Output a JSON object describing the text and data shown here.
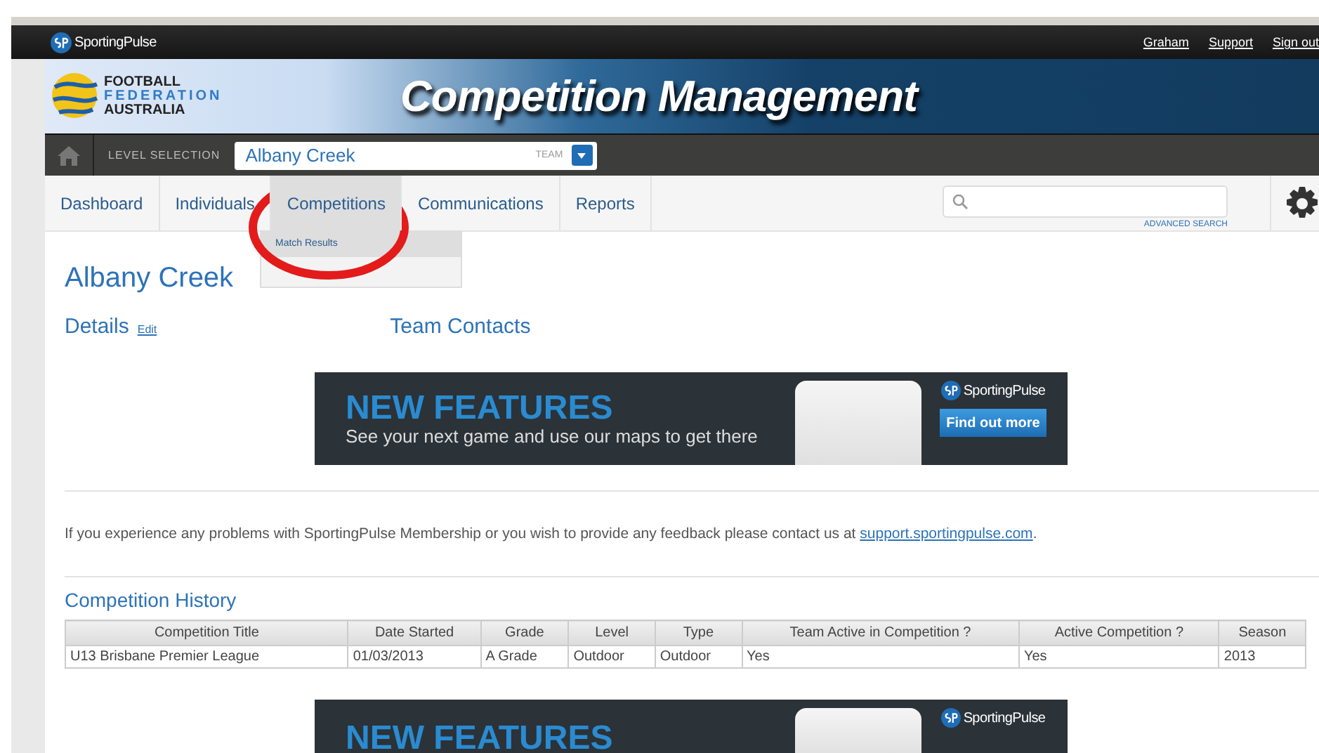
{
  "top_bar": {
    "brand": "SportingPulse",
    "links": [
      "Graham",
      "Support",
      "Sign out"
    ]
  },
  "header": {
    "org_lines": [
      "FOOTBALL",
      "FEDERATION",
      "AUSTRALIA"
    ],
    "title": "Competition Management"
  },
  "level_bar": {
    "label": "LEVEL SELECTION",
    "value": "Albany Creek",
    "level_type": "TEAM"
  },
  "nav": {
    "items": [
      {
        "label": "Dashboard",
        "selected": false
      },
      {
        "label": "Individuals",
        "selected": false
      },
      {
        "label": "Competitions",
        "selected": true
      },
      {
        "label": "Communications",
        "selected": false
      },
      {
        "label": "Reports",
        "selected": false
      }
    ],
    "dropdown": {
      "items": [
        "Match Results"
      ]
    },
    "search": {
      "advanced_link": "ADVANCED SEARCH"
    }
  },
  "page": {
    "heading": "Albany Creek",
    "details": "Details",
    "edit_link": "Edit",
    "team_contacts": "Team Contacts"
  },
  "banners": [
    {
      "headline": "NEW FEATURES",
      "subline": "See your next game and use our maps to get there",
      "brand": "SportingPulse",
      "button": "Find out more"
    },
    {
      "headline": "NEW FEATURES",
      "brand": "SportingPulse"
    }
  ],
  "feedback": {
    "text": "If you experience any problems with SportingPulse Membership or you wish to provide any feedback please contact us at",
    "link": "support.sportingpulse.com",
    "end": "."
  },
  "history": {
    "title": "Competition History",
    "columns": [
      "Competition Title",
      "Date Started",
      "Grade",
      "Level",
      "Type",
      "Team Active in Competition ?",
      "Active Competition ?",
      "Season"
    ],
    "rows": [
      [
        "U13 Brisbane Premier League",
        "01/03/2013",
        "A Grade",
        "Outdoor",
        "Outdoor",
        "Yes",
        "Yes",
        "2013"
      ]
    ]
  }
}
